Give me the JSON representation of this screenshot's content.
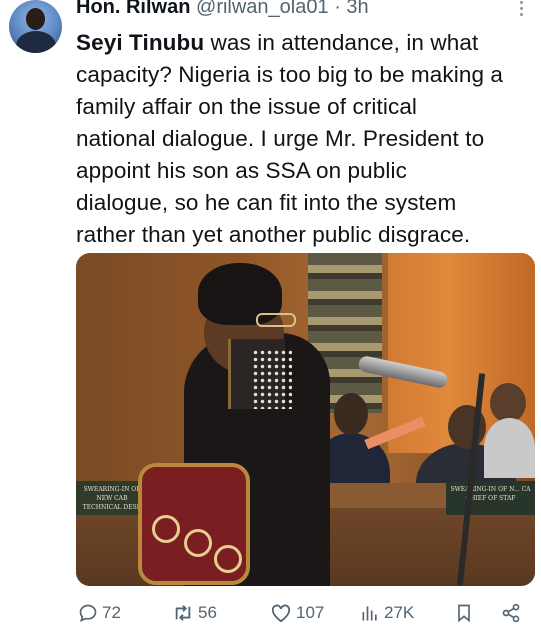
{
  "tweet": {
    "author_name": "Hon. Rilwan",
    "author_handle": "@rilwan_ola01",
    "separator": "·",
    "time": "3h",
    "text_lines": [
      {
        "bold": "Seyi Tinubu",
        "rest": " was in attendance, in what"
      },
      {
        "bold": "",
        "rest": "capacity? Nigeria is too big to be making a"
      },
      {
        "bold": "",
        "rest": "family affair on the issue of critical"
      },
      {
        "bold": "",
        "rest": "national dialogue. I urge Mr. President to"
      },
      {
        "bold": "",
        "rest": "appoint his son as SSA on public"
      },
      {
        "bold": "",
        "rest": "dialogue, so he can fit into the system"
      },
      {
        "bold": "",
        "rest": "rather than yet another public disgrace."
      }
    ],
    "media": {
      "left_nameplate": "SWEARING-IN OF NEW CAB\nTECHNICAL DESK",
      "right_nameplate": "SWEARING-IN OF N... CA\nCHIEF OF STAF"
    }
  },
  "actions": {
    "replies": "72",
    "reposts": "56",
    "likes": "107",
    "views": "27K",
    "icons": [
      "reply-icon",
      "repost-icon",
      "like-icon",
      "views-icon",
      "bookmark-icon",
      "share-icon"
    ]
  },
  "colors": {
    "text": "#0f1419",
    "secondary": "#536471"
  }
}
